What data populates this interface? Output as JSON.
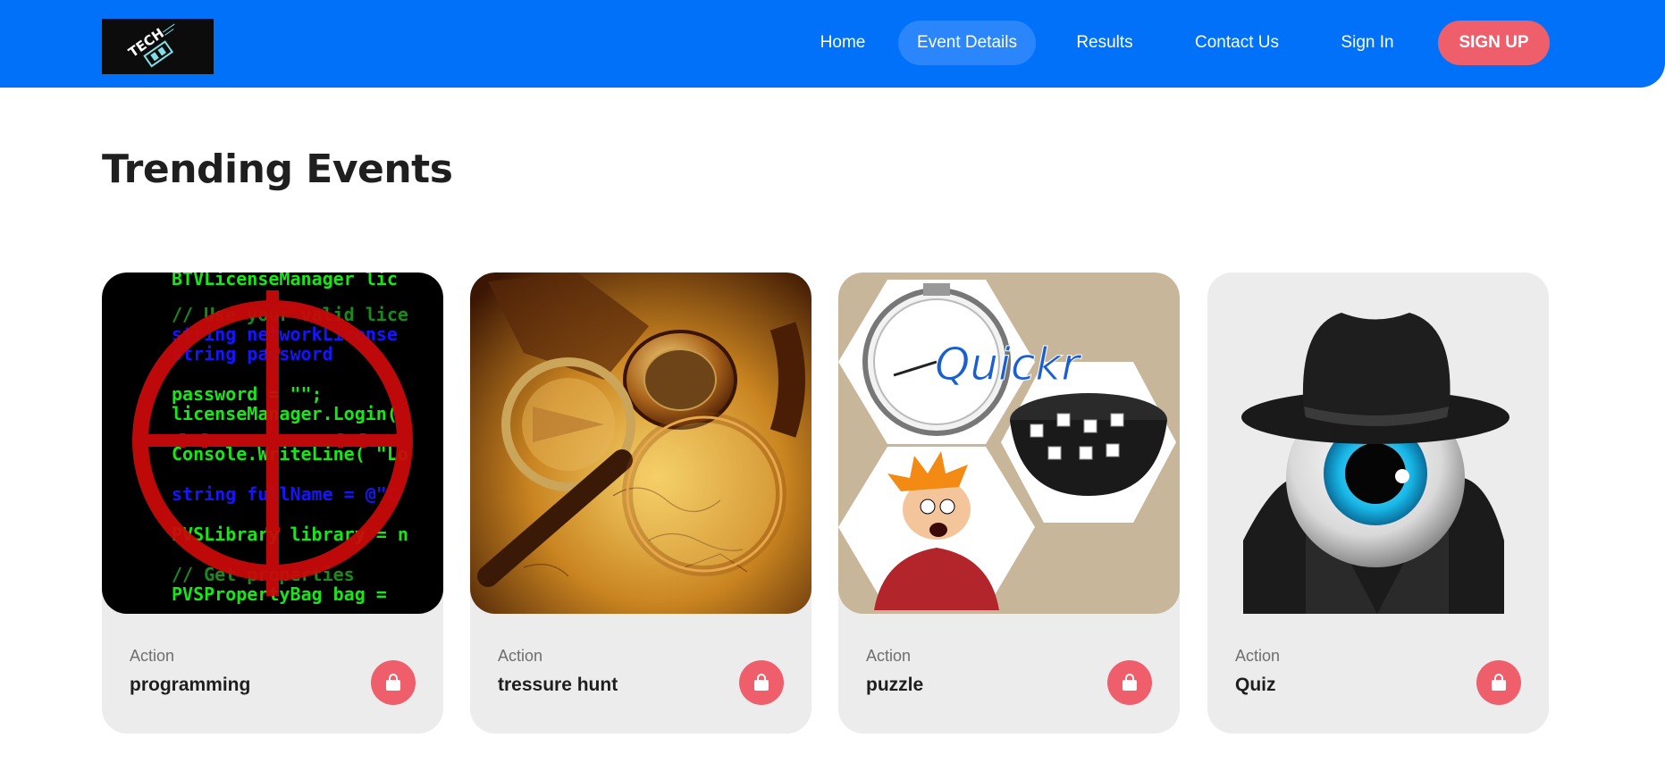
{
  "brand": {
    "logo_text": "TECH",
    "logo_icon": "tech-fest-logo"
  },
  "nav": {
    "items": [
      {
        "label": "Home",
        "active": false
      },
      {
        "label": "Event Details",
        "active": true
      },
      {
        "label": "Results",
        "active": false
      },
      {
        "label": "Contact Us",
        "active": false
      },
      {
        "label": "Sign In",
        "active": false
      }
    ],
    "signup_label": "SIGN UP"
  },
  "main": {
    "title": "Trending Events",
    "cards": [
      {
        "category": "Action",
        "title": "programming",
        "image": "programming-crosshair-image",
        "icon": "shopping-bag-icon"
      },
      {
        "category": "Action",
        "title": "tressure hunt",
        "image": "treasure-map-compass-image",
        "icon": "shopping-bag-icon"
      },
      {
        "category": "Action",
        "title": "puzzle",
        "image": "quickr-puzzle-image",
        "icon": "shopping-bag-icon"
      },
      {
        "category": "Action",
        "title": "Quiz",
        "image": "spy-eyeball-image",
        "icon": "shopping-bag-icon"
      }
    ],
    "code_lines": [
      "BTVLicenseManager lic",
      "// Use your valid lice",
      "string  networkLicense",
      "string  password",
      "password = \"\";",
      "licenseManager.Login(",
      "Console.WriteLine( \"Lo",
      "string  fullName = @\"C",
      "PVSLibrary library = n",
      "// Get properties",
      "PVSPropertyBag bag = "
    ],
    "quickr_text": "Quickr"
  },
  "colors": {
    "header": "#0071f8",
    "accent": "#ee5e6b",
    "card_bg": "#ececec"
  }
}
